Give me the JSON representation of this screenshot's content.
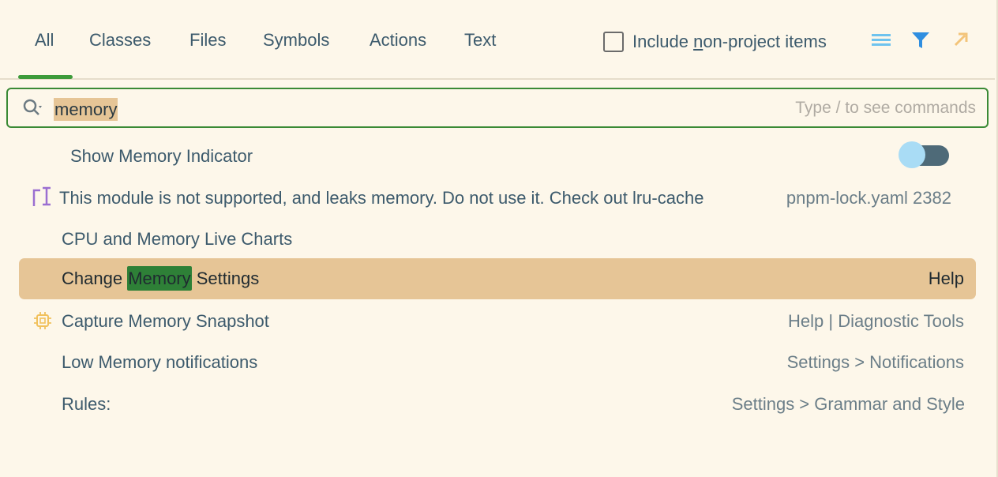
{
  "tabs": [
    {
      "label": "All"
    },
    {
      "label": "Classes"
    },
    {
      "label": "Files"
    },
    {
      "label": "Symbols"
    },
    {
      "label": "Actions"
    },
    {
      "label": "Text"
    }
  ],
  "include_checkbox": {
    "label_pre": "Include ",
    "label_mnemonic": "n",
    "label_post": "on-project items",
    "checked": false
  },
  "toolbar_icons": [
    "list-icon",
    "filter-icon",
    "open-in-window-icon"
  ],
  "colors": {
    "accent_green": "#3d9b3a",
    "selection": "#e6c596",
    "match_highlight": "#2e8037"
  },
  "search": {
    "value": "memory",
    "placeholder": "Type / to see commands"
  },
  "results": [
    {
      "label": "Show Memory Indicator",
      "hint": "",
      "toggle": true
    },
    {
      "label": "This module is not supported, and leaks memory. Do not use it. Check out lru-cache",
      "hint": "pnpm-lock.yaml 2382",
      "icon": "deprecated-marker-icon"
    },
    {
      "label": "CPU and Memory Live Charts",
      "hint": ""
    },
    {
      "label_pre": "Change ",
      "label_match": "Memory",
      "label_post": " Settings",
      "hint": "Help",
      "selected": true
    },
    {
      "label": "Capture Memory Snapshot",
      "hint": "Help | Diagnostic Tools",
      "icon": "chip-icon"
    },
    {
      "label": "Low Memory notifications",
      "hint": "Settings > Notifications"
    },
    {
      "label": "Rules:",
      "hint": "Settings > Grammar and Style"
    }
  ]
}
